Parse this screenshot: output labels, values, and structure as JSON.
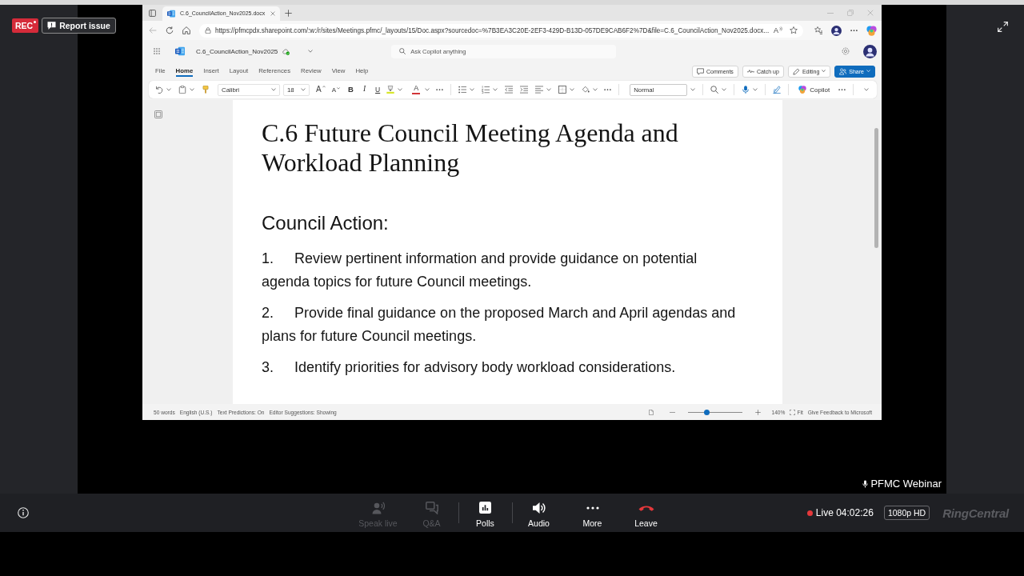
{
  "meeting": {
    "rec_label": "REC",
    "report_button": "Report issue",
    "presenter_label": "PFMC Webinar"
  },
  "browser": {
    "tab_title": "C.6_CouncilAction_Nov2025.docx",
    "url": "https://pfmcpdx.sharepoint.com/:w:/r/sites/Meetings.pfmc/_layouts/15/Doc.aspx?sourcedoc=%7B3EA3C20E-2EF3-429D-B13D-057DE9CAB6F2%7D&file=C.6_CouncilAction_Nov2025.docx...",
    "reader_glyph": "A"
  },
  "word": {
    "doc_name": "C.6_CouncilAction_Nov2025",
    "search": {
      "placeholder": "Ask Copilot anything"
    },
    "ribbon_tabs": [
      {
        "label": "File",
        "selected": false
      },
      {
        "label": "Home",
        "selected": true
      },
      {
        "label": "Insert",
        "selected": false
      },
      {
        "label": "Layout",
        "selected": false
      },
      {
        "label": "References",
        "selected": false
      },
      {
        "label": "Review",
        "selected": false
      },
      {
        "label": "View",
        "selected": false
      },
      {
        "label": "Help",
        "selected": false
      }
    ],
    "header_buttons": [
      {
        "label": "Comments",
        "kind": "comments"
      },
      {
        "label": "Catch up",
        "kind": "catchup"
      },
      {
        "label": "Editing",
        "kind": "editing"
      },
      {
        "label": "Share",
        "kind": "share"
      }
    ],
    "toolbar": {
      "font": "Calibri",
      "font_size": "18",
      "size_buttons": [
        {
          "glyph": "A",
          "kind": "grow"
        },
        {
          "glyph": "A",
          "kind": "shrink"
        }
      ],
      "format_buttons": [
        {
          "glyph": "B",
          "kind": "bold"
        },
        {
          "glyph": "I",
          "kind": "italic"
        },
        {
          "glyph": "U",
          "kind": "underline"
        }
      ],
      "font_color_glyph": "A",
      "style": "Normal",
      "copilot_button": "Copilot"
    }
  },
  "document": {
    "title": "C.6 Future Council Meeting Agenda and Workload Planning",
    "heading": "Council Action:",
    "items": [
      {
        "number": "1.",
        "text": "Review pertinent information and provide guidance on potential agenda topics for future Council meetings."
      },
      {
        "number": "2.",
        "text": "Provide final guidance on the proposed March and April agendas and plans for future Council meetings."
      },
      {
        "number": "3.",
        "text": "Identify priorities for advisory body workload considerations."
      }
    ]
  },
  "status_bar": {
    "items": [
      "50 words",
      "English (U.S.)",
      "Text Predictions: On",
      "Editor Suggestions: Showing"
    ],
    "zoom": {
      "level": 0.33,
      "reading": "140%"
    },
    "fit": "Fit",
    "feedback": "Give Feedback to Microsoft"
  },
  "control_groups": [
    [
      {
        "label": "Speak live",
        "kind": "speak",
        "disabled": true
      },
      {
        "label": "Q&A",
        "kind": "qa",
        "disabled": true
      }
    ],
    [
      {
        "label": "Polls",
        "kind": "polls",
        "disabled": false
      }
    ],
    [
      {
        "label": "Audio",
        "kind": "audio",
        "disabled": false
      },
      {
        "label": "More",
        "kind": "more",
        "disabled": false
      },
      {
        "label": "Leave",
        "kind": "leave",
        "disabled": false
      }
    ]
  ],
  "live": "Live 04:02:26",
  "quality": "1080p HD",
  "brand": "RingCentral"
}
